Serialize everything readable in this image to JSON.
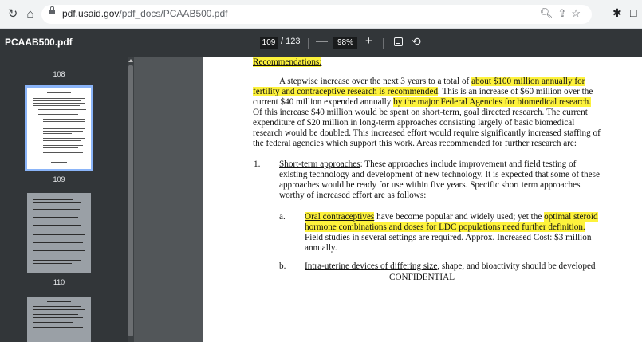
{
  "browser": {
    "url_domain": "pdf.usaid.gov",
    "url_path": "/pdf_docs/PCAAB500.pdf"
  },
  "pdf_toolbar": {
    "title": "PCAAB500.pdf",
    "current_page": "109",
    "page_total": "/ 123",
    "zoom": "98%"
  },
  "sidebar": {
    "thumbnails": [
      {
        "label": "108"
      },
      {
        "label": "109"
      },
      {
        "label": "110"
      }
    ]
  },
  "document": {
    "heading": "Recommendations:",
    "para1": [
      {
        "t": "A stepwise increase over the next 3 years to a total of ",
        "h": false
      },
      {
        "t": "about $100 million annually for",
        "h": true
      }
    ],
    "para2": [
      {
        "t": "fertility and contraceptive research is recommended",
        "h": true
      },
      {
        "t": ". This is an increase of $60 million over the",
        "h": false
      }
    ],
    "para3": [
      {
        "t": "current $40 million expended annually ",
        "h": false
      },
      {
        "t": "by the major Federal Agencies for biomedical research.",
        "h": true
      }
    ],
    "para4": "Of this increase $40 million would be spent on short-term, goal directed research. The current",
    "para5": "expenditure of $20 million in long-term approaches consisting largely of basic biomedical",
    "para6": "research would be doubled. This increased effort would require significantly increased staffing of",
    "para7": "the federal agencies which support this work. Areas recommended for further research are:",
    "item1_number": "1.",
    "item1_title": "Short-term approaches",
    "item1_l1": ": These approaches include improvement and field testing of",
    "item1_l2": "existing technology and development of new technology. It is expected that some of these",
    "item1_l3": "approaches would be ready for use within five years. Specific short term approaches",
    "item1_l4": "worthy of increased effort are as follows:",
    "itema_letter": "a.",
    "itema_title": "Oral contraceptives",
    "itema_l1_mid": " have become popular and widely used; yet the ",
    "itema_l1_hl": "optimal steroid",
    "itema_l2": "hormone combinations and doses for LDC populations need further definition.",
    "itema_l3": "Field studies in several settings are required. Approx. Increased Cost: $3 million",
    "itema_l4": "annually.",
    "itemb_letter": "b.",
    "itemb_title": "Intra-uterine devices of differing size",
    "itemb_rest": ", shape, and bioactivity should be developed",
    "footer": "CONFIDENTIAL"
  }
}
